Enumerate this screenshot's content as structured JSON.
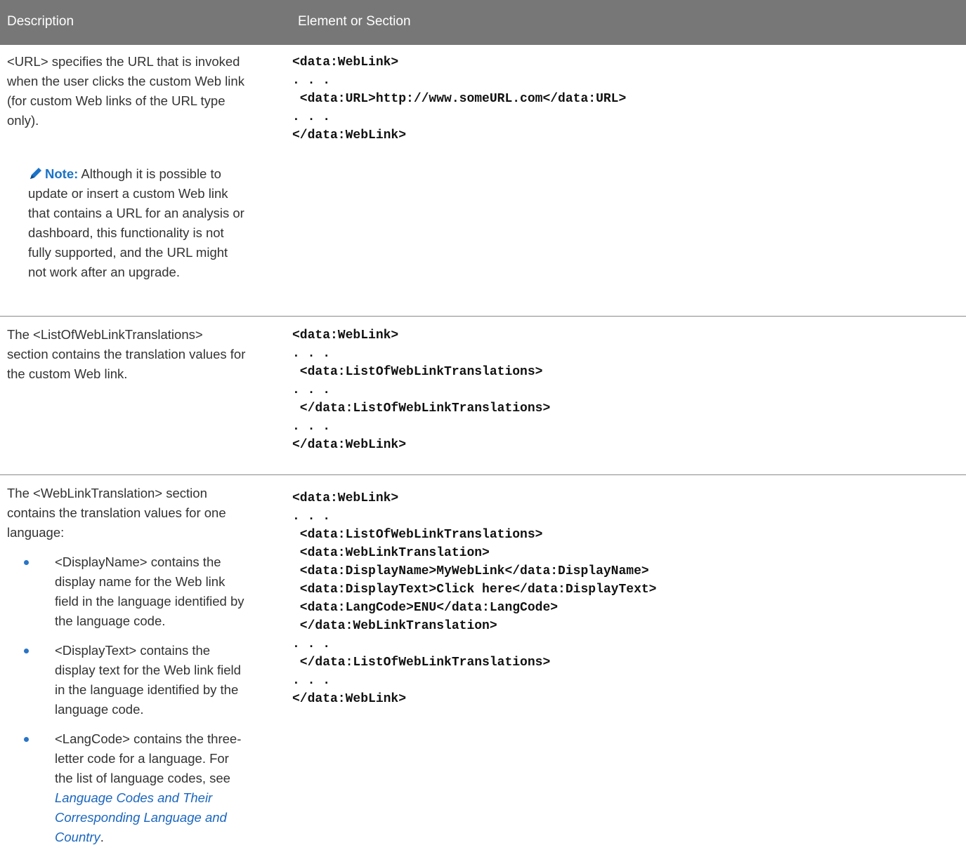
{
  "header": {
    "description": "Description",
    "element_or_section": "Element or Section"
  },
  "rows": [
    {
      "description": "<URL> specifies the URL that is invoked when the user clicks the custom Web link (for custom Web links of the URL type only).",
      "note": {
        "label": "Note:",
        "text": "Although it is possible to update or insert a custom Web link that contains a URL for an analysis or dashboard, this functionality is not fully supported, and the URL might not work after an upgrade."
      },
      "code": [
        "<data:WebLink>",
        ". . .",
        " <data:URL>http://www.someURL.com</data:URL>",
        ". . .",
        "</data:WebLink>"
      ]
    },
    {
      "description": "The <ListOfWebLinkTranslations> section contains the translation values for the custom Web link.",
      "code": [
        "<data:WebLink>",
        ". . .",
        " <data:ListOfWebLinkTranslations>",
        ". . .",
        " </data:ListOfWebLinkTranslations>",
        ". . .",
        "</data:WebLink>"
      ]
    },
    {
      "description": "The <WebLinkTranslation> section contains the translation values for one language:",
      "bullets": [
        {
          "text": "<DisplayName> contains the display name for the Web link field in the language identified by the language code."
        },
        {
          "text": "<DisplayText> contains the display text for the Web link field in the language identified by the language code."
        },
        {
          "text_before": "<LangCode> contains the three-letter code for a language. For the list of language codes, see ",
          "link": "Language Codes and Their Corresponding Language and Country",
          "text_after": "."
        }
      ],
      "code": [
        "<data:WebLink>",
        ". . .",
        " <data:ListOfWebLinkTranslations>",
        " <data:WebLinkTranslation>",
        " <data:DisplayName>MyWebLink</data:DisplayName>",
        " <data:DisplayText>Click here</data:DisplayText>",
        " <data:LangCode>ENU</data:LangCode>",
        " </data:WebLinkTranslation>",
        ". . .",
        " </data:ListOfWebLinkTranslations>",
        ". . .",
        "</data:WebLink>"
      ]
    }
  ],
  "colors": {
    "header_bg": "#777777",
    "note_label": "#1a73c7",
    "link": "#1a66c0",
    "bullet": "#2a74c7"
  },
  "icons": {
    "note": "pencil-icon"
  }
}
